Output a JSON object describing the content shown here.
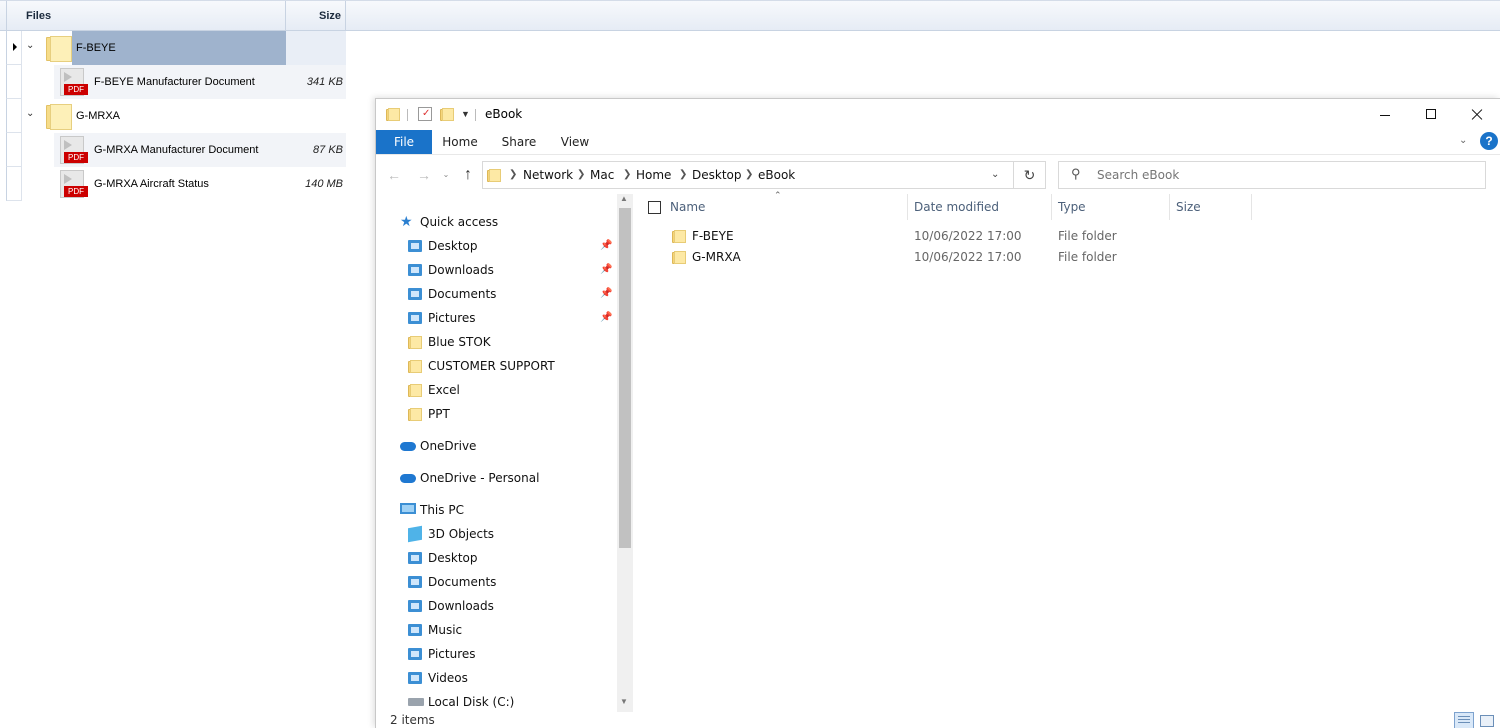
{
  "tree": {
    "header": {
      "files": "Files",
      "size": "Size"
    },
    "rows": [
      {
        "name": "F-BEYE",
        "type": "folder",
        "size": ""
      },
      {
        "name": "F-BEYE Manufacturer Document",
        "type": "pdf",
        "size": "341 KB"
      },
      {
        "name": "G-MRXA",
        "type": "folder",
        "size": ""
      },
      {
        "name": "G-MRXA Manufacturer Document",
        "type": "pdf",
        "size": "87 KB"
      },
      {
        "name": "G-MRXA Aircraft Status",
        "type": "pdf",
        "size": "140 MB"
      }
    ],
    "pdf_badge": "PDF"
  },
  "explorer": {
    "title": "eBook",
    "ribbon_tabs": [
      "File",
      "Home",
      "Share",
      "View"
    ],
    "help": "?",
    "breadcrumb": [
      "Network",
      "Mac",
      "Home",
      "Desktop",
      "eBook"
    ],
    "search": {
      "placeholder": "Search eBook"
    },
    "nav": {
      "quick_access": "Quick access",
      "quick_items": [
        "Desktop",
        "Downloads",
        "Documents",
        "Pictures",
        "Blue STOK",
        "CUSTOMER SUPPORT",
        "Excel",
        "PPT"
      ],
      "onedrive": "OneDrive",
      "onedrive_personal": "OneDrive - Personal",
      "this_pc": "This PC",
      "pc_items": [
        "3D Objects",
        "Desktop",
        "Documents",
        "Downloads",
        "Music",
        "Pictures",
        "Videos",
        "Local Disk (C:)"
      ]
    },
    "columns": {
      "name": "Name",
      "date": "Date modified",
      "type": "Type",
      "size": "Size"
    },
    "files": [
      {
        "name": "F-BEYE",
        "date": "10/06/2022 17:00",
        "type": "File folder"
      },
      {
        "name": "G-MRXA",
        "date": "10/06/2022 17:00",
        "type": "File folder"
      }
    ],
    "status": "2 items"
  },
  "colors": {
    "accent": "#1a73c9",
    "tree_selection": "#9fb3cd",
    "folder": "#f6d57a"
  }
}
